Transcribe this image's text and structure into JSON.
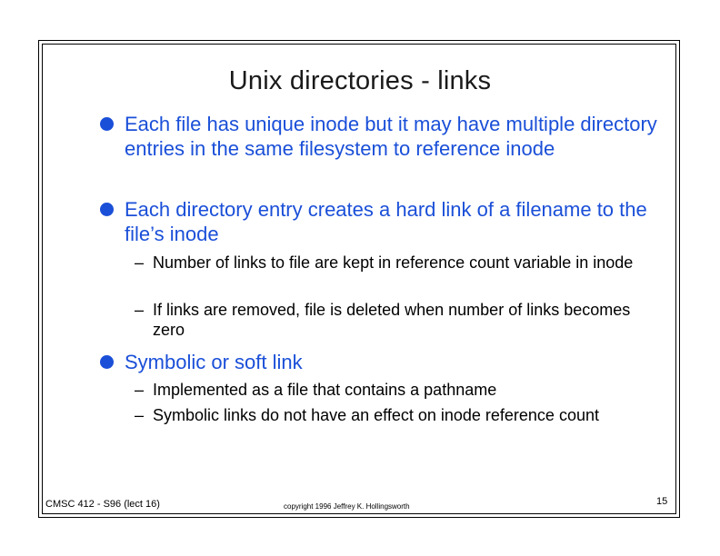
{
  "slide": {
    "title": "Unix directories - links",
    "bullets": [
      {
        "text": "Each file has unique inode but it may have multiple directory entries in the same filesystem to reference inode"
      },
      {
        "text": "Each directory entry creates a hard link of a filename to the file’s inode",
        "subs": [
          "Number of links to file are kept in reference count variable in inode",
          "If links are removed, file is deleted when number of links becomes zero"
        ]
      },
      {
        "text": "Symbolic or soft link",
        "subs": [
          "Implemented as a file that contains a pathname",
          "Symbolic links do not have an effect on inode reference count"
        ]
      }
    ],
    "sub_marker": "–"
  },
  "footer": {
    "course": "CMSC 412 - S96  (lect 16)",
    "copyright": "copyright 1996  Jeffrey K. Hollingsworth",
    "page": "15"
  },
  "colors": {
    "bullet_text": "#1a4fd8",
    "title": "#1a1a1a"
  }
}
